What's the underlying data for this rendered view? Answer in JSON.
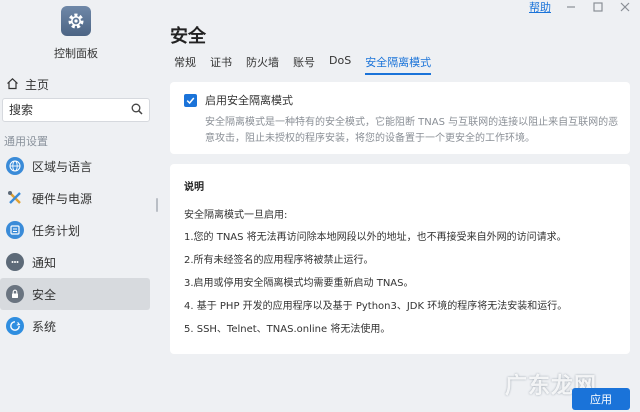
{
  "window": {
    "help_label": "帮助",
    "minimize_icon": "minimize-icon",
    "maximize_icon": "maximize-icon",
    "close_icon": "close-icon"
  },
  "app": {
    "title": "控制面板",
    "icon": "gear-icon"
  },
  "sidebar": {
    "home_label": "主页",
    "search_placeholder": "搜索",
    "section_label": "通用设置",
    "items": [
      {
        "label": "区域与语言",
        "icon": "globe-icon",
        "color": "#3a8bd8",
        "active": false
      },
      {
        "label": "硬件与电源",
        "icon": "tools-icon",
        "color": "#e0a030",
        "active": false
      },
      {
        "label": "任务计划",
        "icon": "task-icon",
        "color": "#3a8bd8",
        "active": false
      },
      {
        "label": "通知",
        "icon": "chat-icon",
        "color": "#5d6a78",
        "active": false
      },
      {
        "label": "安全",
        "icon": "lock-icon",
        "color": "#6a7480",
        "active": true
      },
      {
        "label": "系统",
        "icon": "system-icon",
        "color": "#2f8ee0",
        "active": false
      }
    ]
  },
  "main": {
    "title": "安全",
    "tabs": [
      {
        "label": "常规",
        "active": false
      },
      {
        "label": "证书",
        "active": false
      },
      {
        "label": "防火墙",
        "active": false
      },
      {
        "label": "账号",
        "active": false
      },
      {
        "label": "DoS",
        "active": false
      },
      {
        "label": "安全隔离模式",
        "active": true
      }
    ],
    "secure_mode": {
      "checked": true,
      "label": "启用安全隔离模式",
      "description": "安全隔离模式是一种特有的安全模式，它能阻断 TNAS 与互联网的连接以阻止来自互联网的恶意攻击，阻止未授权的程序安装，将您的设备置于一个更安全的工作环境。"
    },
    "notes": {
      "title": "说明",
      "intro": "安全隔离模式一旦启用:",
      "items": [
        "1.您的 TNAS 将无法再访问除本地网段以外的地址，也不再接受来自外网的访问请求。",
        "2.所有未经签名的应用程序将被禁止运行。",
        "3.启用或停用安全隔离模式均需要重新启动 TNAS。",
        "4. 基于 PHP 开发的应用程序以及基于 Python3、JDK 环境的程序将无法安装和运行。",
        "5. SSH、Telnet、TNAS.online 将无法使用。"
      ]
    },
    "apply_label": "应用"
  },
  "watermark": "广东龙网",
  "colors": {
    "accent": "#1a73d9",
    "background": "#eef0f3",
    "card": "#ffffff"
  }
}
